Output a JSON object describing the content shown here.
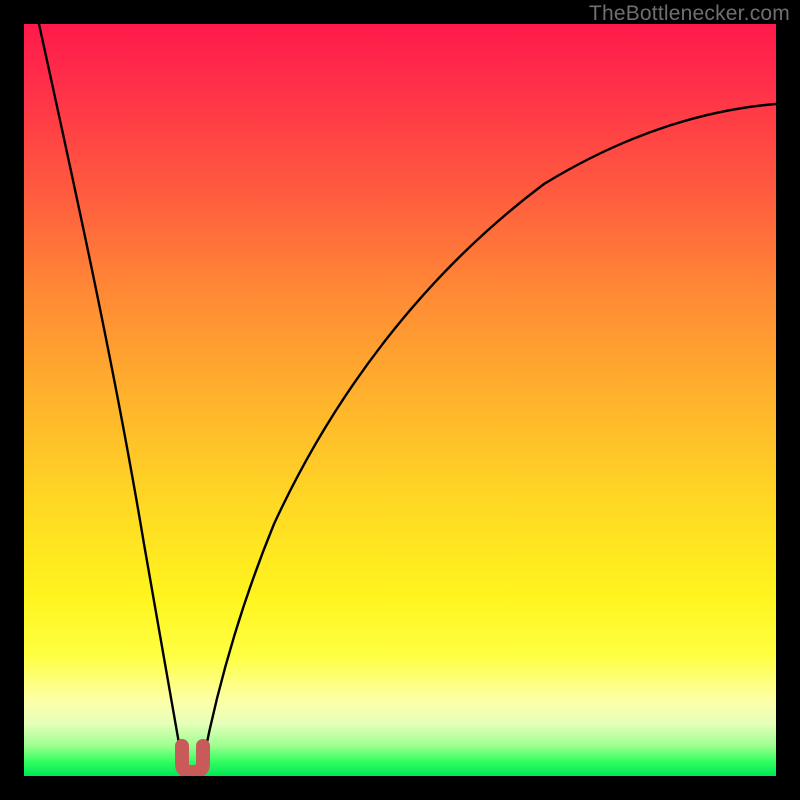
{
  "watermark": {
    "text": "TheBottlenecker.com"
  },
  "chart_data": {
    "type": "line",
    "title": "",
    "xlabel": "",
    "ylabel": "",
    "xlim": [
      0,
      100
    ],
    "ylim": [
      0,
      100
    ],
    "gradient_stops": [
      {
        "pos": 0,
        "color": "#ff1a4b"
      },
      {
        "pos": 22,
        "color": "#ff5a3f"
      },
      {
        "pos": 50,
        "color": "#ffb32c"
      },
      {
        "pos": 76,
        "color": "#fff41e"
      },
      {
        "pos": 93,
        "color": "#e6ffba"
      },
      {
        "pos": 100,
        "color": "#00e656"
      }
    ],
    "series": [
      {
        "name": "left-branch",
        "x": [
          2,
          6,
          10,
          14,
          17,
          19,
          20.5,
          21.3
        ],
        "values": [
          100,
          80,
          60,
          40,
          22,
          10,
          3,
          0.3
        ]
      },
      {
        "name": "right-branch",
        "x": [
          23.5,
          25,
          28,
          33,
          40,
          48,
          58,
          70,
          84,
          100
        ],
        "values": [
          0.3,
          4,
          14,
          30,
          46,
          58,
          68,
          77,
          84,
          89
        ]
      }
    ],
    "marker": {
      "name": "minimum-u-marker",
      "x": 22.4,
      "y": 0.6,
      "width": 3.2,
      "height": 3.6,
      "color": "#c85a5a"
    }
  }
}
